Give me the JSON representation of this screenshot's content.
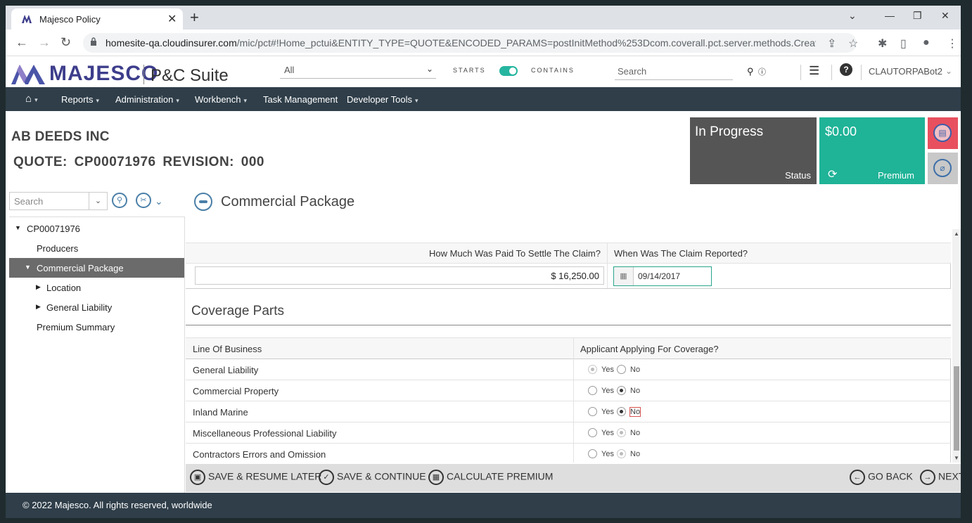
{
  "browser": {
    "tab_title": "Majesco Policy",
    "url_host": "homesite-qa.cloudinsurer.com",
    "url_path": "/mic/pct#!Home_pctui&ENTITY_TYPE=QUOTE&ENCODED_PARAMS=postInitMethod%253Dcom.coverall.pct.server.methods.Create..."
  },
  "header": {
    "brand": "MAJESCO",
    "suite": "P&C Suite",
    "scope_select": "All",
    "starts_label": "STARTS",
    "contains_label": "CONTAINS",
    "search_placeholder": "Search",
    "user": "CLAUTORPABot2"
  },
  "nav": {
    "items": [
      "Reports",
      "Administration",
      "Workbench",
      "Task Management",
      "Developer Tools"
    ]
  },
  "account": {
    "name": "AB DEEDS INC",
    "quote_line": "QUOTE:  CP00071976  REVISION:  000"
  },
  "tiles": {
    "status_value": "In Progress",
    "status_label": "Status",
    "premium_value": "$0.00",
    "premium_label": "Premium"
  },
  "left_panel": {
    "search_placeholder": "Search",
    "tree": [
      {
        "label": "CP00071976"
      },
      {
        "label": "Producers"
      },
      {
        "label": "Commercial Package"
      },
      {
        "label": "Location"
      },
      {
        "label": "General Liability"
      },
      {
        "label": "Premium Summary"
      }
    ]
  },
  "main": {
    "page_title": "Commercial Package",
    "claim": {
      "col_paid": "How Much Was Paid To Settle The Claim?",
      "col_reported": "When Was The Claim Reported?",
      "paid_value": "$ 16,250.00",
      "reported_value": "09/14/2017"
    },
    "coverage": {
      "title": "Coverage Parts",
      "col_lob": "Line Of Business",
      "col_applying": "Applicant Applying For Coverage?",
      "yes_label": "Yes",
      "no_label": "No",
      "rows": [
        {
          "name": "General Liability"
        },
        {
          "name": "Commercial Property"
        },
        {
          "name": "Inland Marine"
        },
        {
          "name": "Miscellaneous Professional Liability"
        },
        {
          "name": "Contractors Errors and Omission"
        }
      ]
    }
  },
  "actions": {
    "save_resume": "SAVE & RESUME LATER",
    "save_continue": "SAVE & CONTINUE",
    "calculate": "CALCULATE PREMIUM",
    "go_back": "GO BACK",
    "next": "NEXT"
  },
  "footer": {
    "copyright": "2022 Majesco. All rights reserved, worldwide"
  },
  "colors": {
    "nav_bg": "#2f3e49",
    "status_tile": "#555555",
    "premium_tile": "#1fb397",
    "chat_tile": "#e8505f",
    "brand": "#3d3d8c"
  }
}
